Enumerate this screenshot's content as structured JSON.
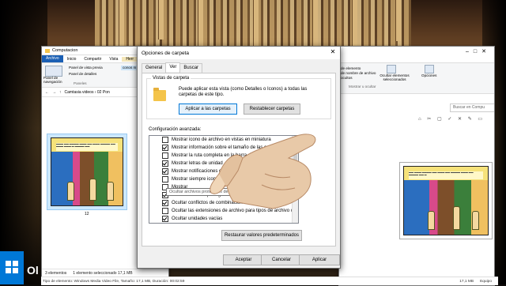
{
  "left_window": {
    "title": "Computacion",
    "tabs": [
      "Archivo",
      "Inicio",
      "Compartir",
      "Vista",
      "Herr"
    ],
    "ribbon": {
      "preview_pane": "Panel de vista previa",
      "details_pane": "Panel de detalles",
      "nav_pane": "Panel de navegación",
      "icons_label": "conos m",
      "group_label": "Paneles"
    },
    "breadcrumb": "Camtasia videos › 02 Pon",
    "thumb_label": "12",
    "status_items": "3 elementos",
    "status_selected": "1 elemento seleccionado  17,1 MB"
  },
  "dialog": {
    "title": "Opciones de carpeta",
    "close": "✕",
    "tabs": [
      "General",
      "Ver",
      "Buscar"
    ],
    "active_tab": "Ver",
    "views_group": "Vistas de carpeta",
    "views_desc": "Puede aplicar esta vista (como Detalles o Iconos) a todas las carpetas de este tipo.",
    "apply_folders_btn": "Aplicar a las carpetas",
    "reset_folders_btn": "Restablecer carpetas",
    "advanced_label": "Configuración avanzada:",
    "settings": [
      {
        "label": "Mostrar icono de archivo en vistas en miniatura",
        "checked": false
      },
      {
        "label": "Mostrar información sobre el tamaño de las carpetas",
        "checked": true
      },
      {
        "label": "Mostrar la ruta completa en la barra de título",
        "checked": false
      },
      {
        "label": "Mostrar letras de unidad",
        "checked": true
      },
      {
        "label": "Mostrar notificaciones del proveedor",
        "checked": true
      },
      {
        "label": "Mostrar siempre iconos",
        "checked": false
      },
      {
        "label": "Mostrar",
        "checked": false
      },
      {
        "label": "Ocultar archivos protegidos del sistema (recomendado)",
        "checked": true
      },
      {
        "label": "Ocultar conflictos de combinación",
        "checked": true
      },
      {
        "label": "Ocultar las extensiones de archivo para tipos de archivo c",
        "checked": false
      },
      {
        "label": "Ocultar unidades vacías",
        "checked": true
      }
    ],
    "tooltip": "Ocultar archivos protegidos del sistema (recomendado)",
    "restore_defaults_btn": "Restaurar valores predeterminados",
    "ok_btn": "Aceptar",
    "cancel_btn": "Cancelar",
    "apply_btn": "Aplicar"
  },
  "right_window": {
    "ribbon_items": [
      "de elemento",
      "Ocultar elementos seleccionados",
      "Opciones"
    ],
    "ribbon_small": [
      "de nombre de archivo",
      "ocultos"
    ],
    "group_label": "Mostrar u ocultar",
    "search_placeholder": "Buscar en Compu",
    "size": "17,1 MB",
    "device": "Equipo"
  },
  "bottom_status": {
    "type": "Tipo de elemento: Windows Media Video File, Tamaño: 17,1 MB, Duración: 00:02:59"
  },
  "taskbar": {
    "ol": "Ol"
  },
  "colors": {
    "accent": "#0078d7",
    "file_tab": "#1a5fb4"
  }
}
